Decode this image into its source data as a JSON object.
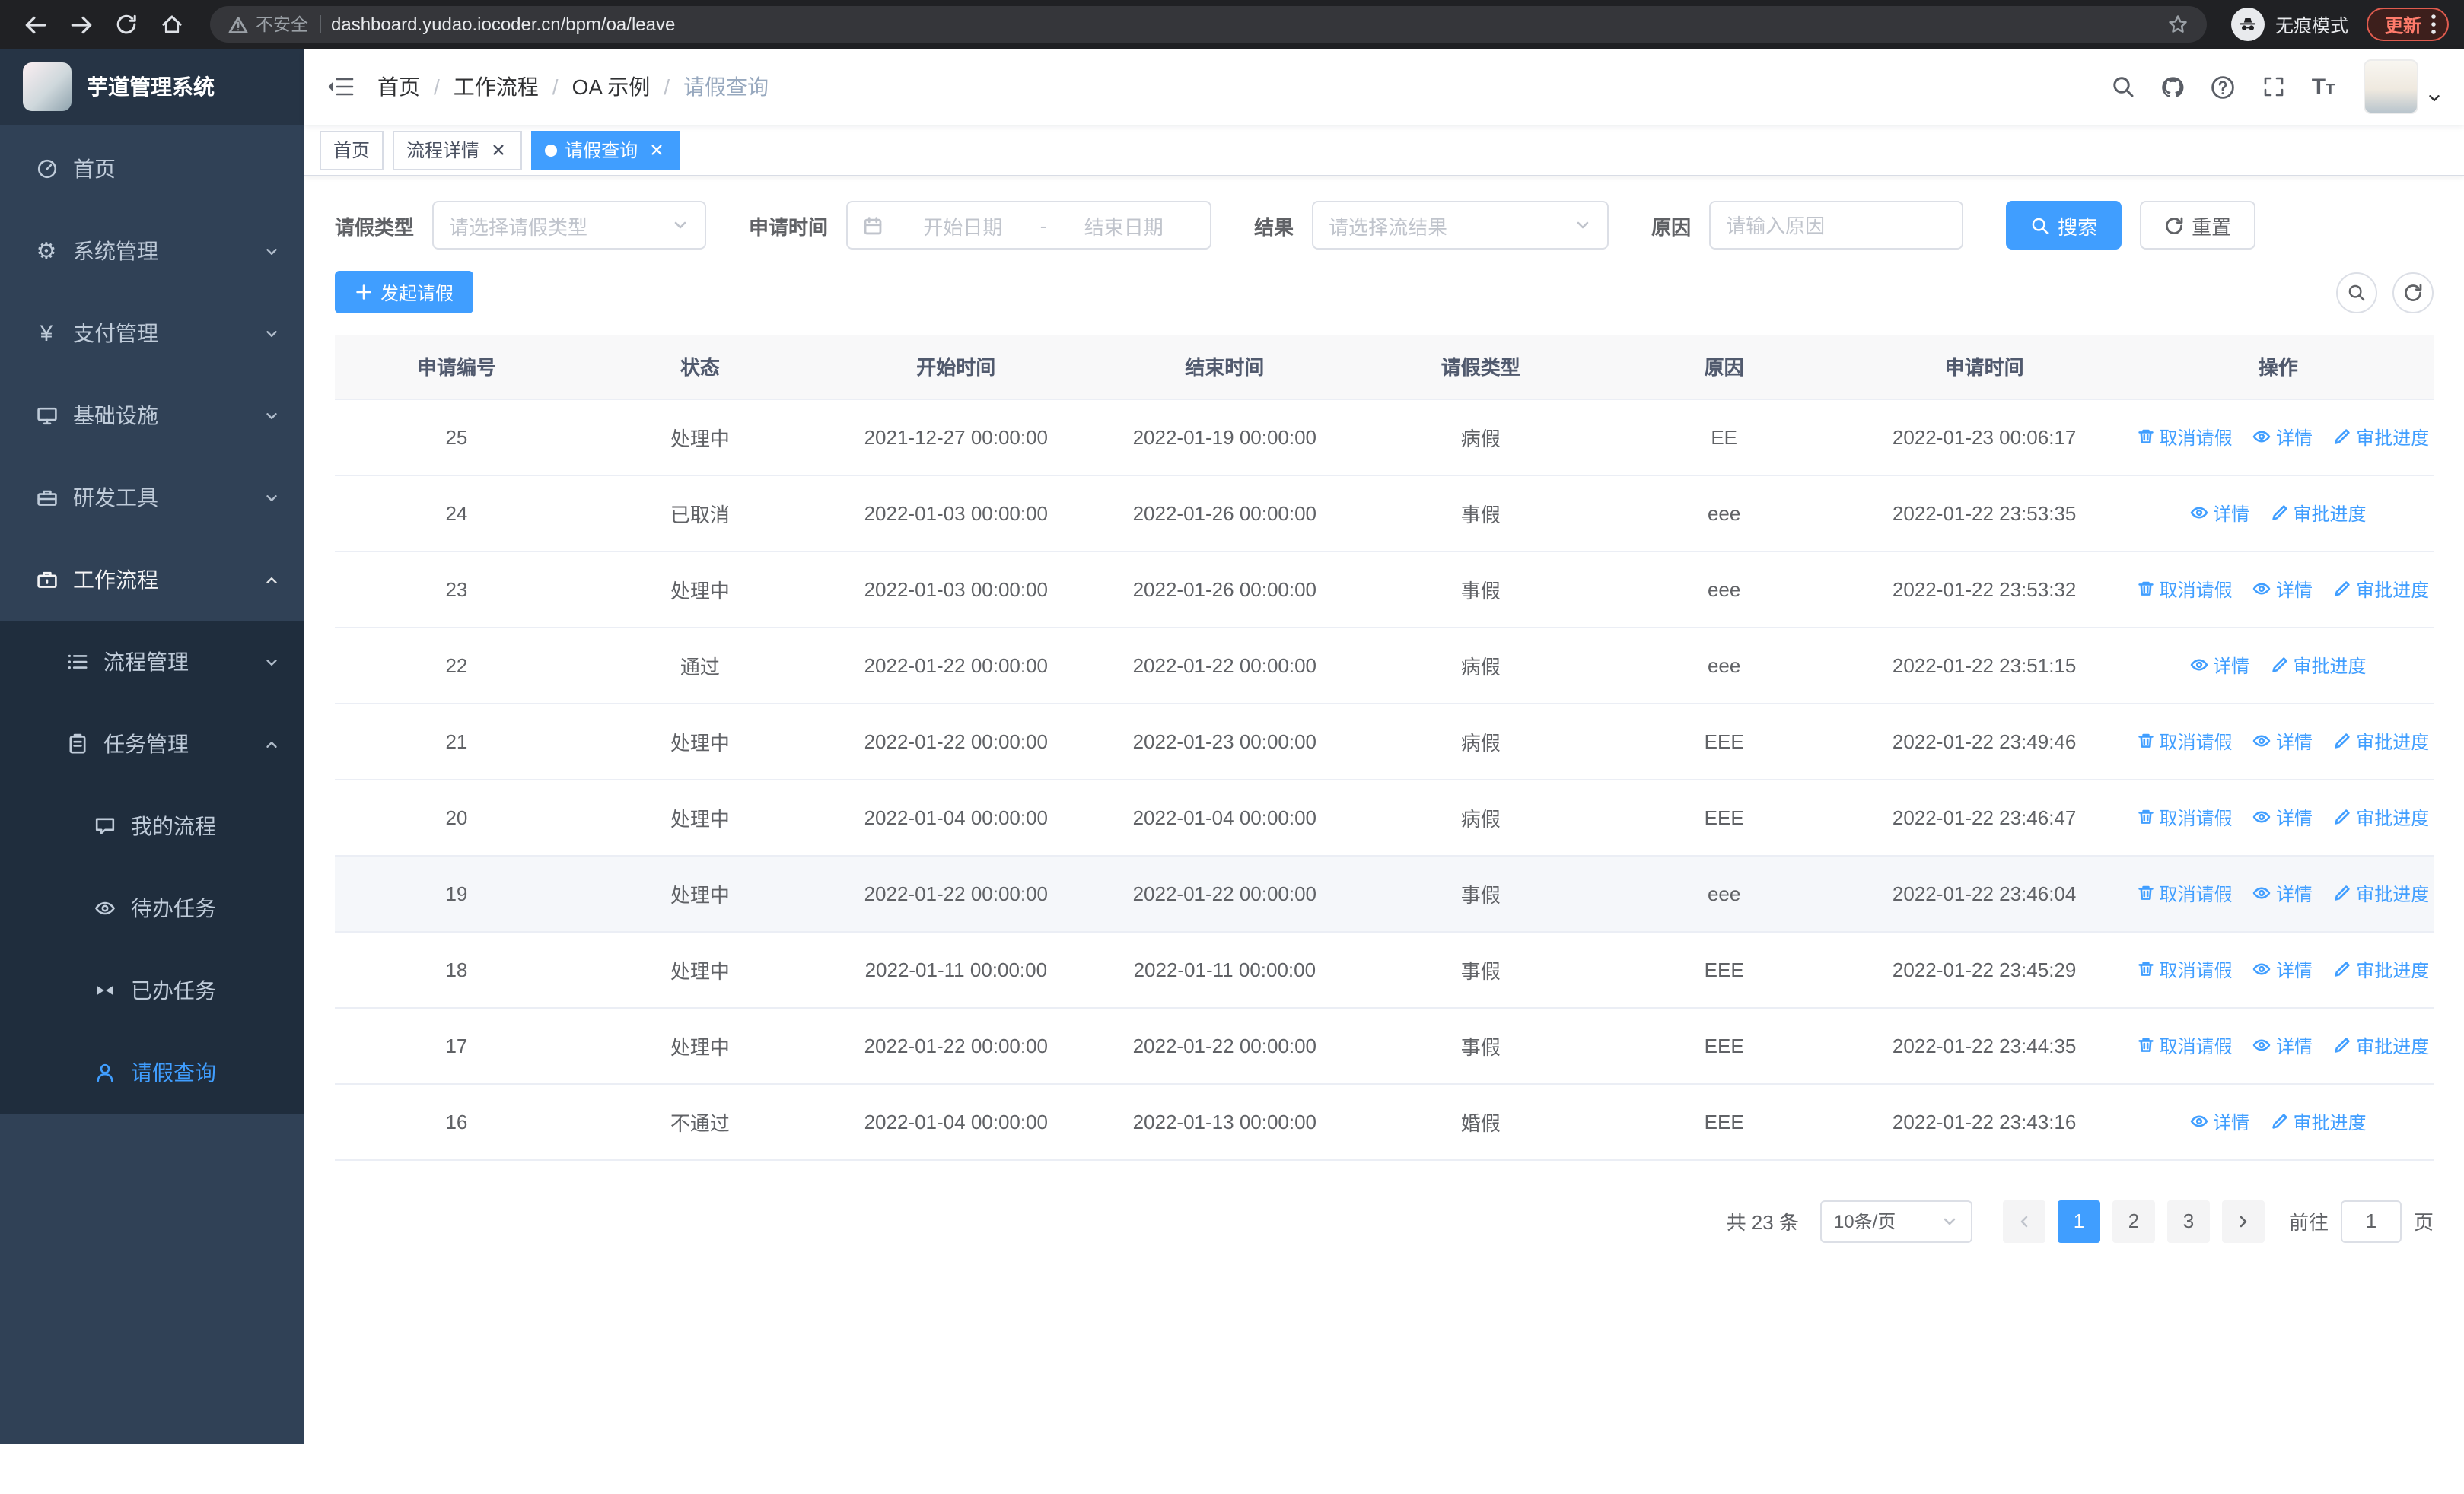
{
  "browser": {
    "security_warning": "不安全",
    "url": "dashboard.yudao.iocoder.cn/bpm/oa/leave",
    "incognito_label": "无痕模式",
    "update_label": "更新"
  },
  "sidebar": {
    "logo_title": "芋道管理系统",
    "items": [
      {
        "label": "首页",
        "icon": "dashboard-icon"
      },
      {
        "label": "系统管理",
        "icon": "gear-icon"
      },
      {
        "label": "支付管理",
        "icon": "yen-icon"
      },
      {
        "label": "基础设施",
        "icon": "monitor-icon"
      },
      {
        "label": "研发工具",
        "icon": "toolbox-icon"
      },
      {
        "label": "工作流程",
        "icon": "briefcase-icon"
      },
      {
        "label": "流程管理",
        "icon": "list-icon"
      },
      {
        "label": "任务管理",
        "icon": "clipboard-icon"
      },
      {
        "label": "我的流程",
        "icon": "chat-icon"
      },
      {
        "label": "待办任务",
        "icon": "eye-icon"
      },
      {
        "label": "已办任务",
        "icon": "bowtie-icon"
      },
      {
        "label": "请假查询",
        "icon": "user-icon"
      }
    ]
  },
  "header": {
    "separator": "/",
    "breadcrumb": [
      "首页",
      "工作流程",
      "OA 示例",
      "请假查询"
    ]
  },
  "tabs": [
    {
      "label": "首页"
    },
    {
      "label": "流程详情"
    },
    {
      "label": "请假查询"
    }
  ],
  "filters": {
    "leave_type_label": "请假类型",
    "leave_type_placeholder": "请选择请假类型",
    "apply_time_label": "申请时间",
    "start_date_placeholder": "开始日期",
    "range_separator": "-",
    "end_date_placeholder": "结束日期",
    "result_label": "结果",
    "result_placeholder": "请选择流结果",
    "reason_label": "原因",
    "reason_placeholder": "请输入原因",
    "search_button": "搜索",
    "reset_button": "重置"
  },
  "toolbar": {
    "create_button": "发起请假"
  },
  "table": {
    "columns": [
      "申请编号",
      "状态",
      "开始时间",
      "结束时间",
      "请假类型",
      "原因",
      "申请时间",
      "操作"
    ],
    "actions": {
      "cancel": "取消请假",
      "detail": "详情",
      "progress": "审批进度"
    },
    "rows": [
      {
        "id": "25",
        "status": "处理中",
        "start": "2021-12-27 00:00:00",
        "end": "2022-01-19 00:00:00",
        "type": "病假",
        "reason": "EE",
        "applied": "2022-01-23 00:06:17",
        "can_cancel": true
      },
      {
        "id": "24",
        "status": "已取消",
        "start": "2022-01-03 00:00:00",
        "end": "2022-01-26 00:00:00",
        "type": "事假",
        "reason": "eee",
        "applied": "2022-01-22 23:53:35",
        "can_cancel": false
      },
      {
        "id": "23",
        "status": "处理中",
        "start": "2022-01-03 00:00:00",
        "end": "2022-01-26 00:00:00",
        "type": "事假",
        "reason": "eee",
        "applied": "2022-01-22 23:53:32",
        "can_cancel": true
      },
      {
        "id": "22",
        "status": "通过",
        "start": "2022-01-22 00:00:00",
        "end": "2022-01-22 00:00:00",
        "type": "病假",
        "reason": "eee",
        "applied": "2022-01-22 23:51:15",
        "can_cancel": false
      },
      {
        "id": "21",
        "status": "处理中",
        "start": "2022-01-22 00:00:00",
        "end": "2022-01-23 00:00:00",
        "type": "病假",
        "reason": "EEE",
        "applied": "2022-01-22 23:49:46",
        "can_cancel": true
      },
      {
        "id": "20",
        "status": "处理中",
        "start": "2022-01-04 00:00:00",
        "end": "2022-01-04 00:00:00",
        "type": "病假",
        "reason": "EEE",
        "applied": "2022-01-22 23:46:47",
        "can_cancel": true
      },
      {
        "id": "19",
        "status": "处理中",
        "start": "2022-01-22 00:00:00",
        "end": "2022-01-22 00:00:00",
        "type": "事假",
        "reason": "eee",
        "applied": "2022-01-22 23:46:04",
        "can_cancel": true
      },
      {
        "id": "18",
        "status": "处理中",
        "start": "2022-01-11 00:00:00",
        "end": "2022-01-11 00:00:00",
        "type": "事假",
        "reason": "EEE",
        "applied": "2022-01-22 23:45:29",
        "can_cancel": true
      },
      {
        "id": "17",
        "status": "处理中",
        "start": "2022-01-22 00:00:00",
        "end": "2022-01-22 00:00:00",
        "type": "事假",
        "reason": "EEE",
        "applied": "2022-01-22 23:44:35",
        "can_cancel": true
      },
      {
        "id": "16",
        "status": "不通过",
        "start": "2022-01-04 00:00:00",
        "end": "2022-01-13 00:00:00",
        "type": "婚假",
        "reason": "EEE",
        "applied": "2022-01-22 23:43:16",
        "can_cancel": false
      }
    ]
  },
  "pagination": {
    "total": "共 23 条",
    "page_size": "10条/页",
    "pages": [
      "1",
      "2",
      "3"
    ],
    "active_page": "1",
    "goto_label": "前往",
    "goto_value": "1",
    "page_unit": "页"
  },
  "colors": {
    "primary": "#409EFF",
    "sidebar_bg": "#304156",
    "submenu_bg": "#1f2d3d",
    "browser_bar_bg": "#202124"
  }
}
